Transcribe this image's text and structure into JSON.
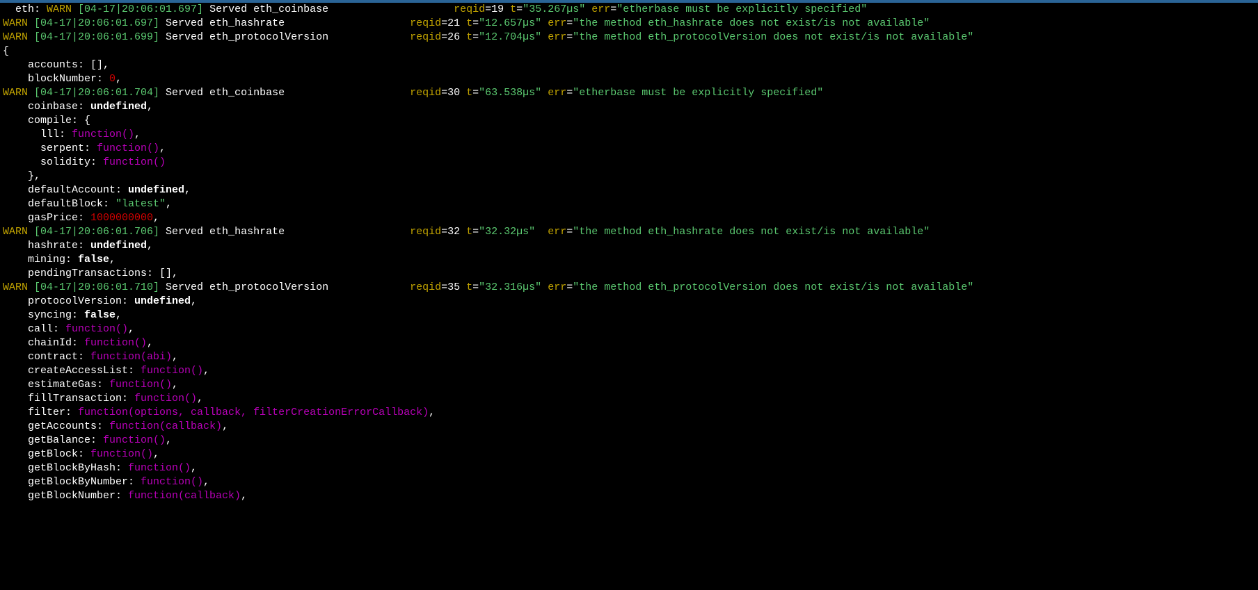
{
  "colors": {
    "warn": "#c2a400",
    "ts": "#5bc970",
    "num": "#d20000",
    "fn": "#b800b8"
  },
  "line0_prefix": "  eth: ",
  "logs": [
    {
      "warn": "WARN ",
      "ts": "[04-17|20:06:01.697]",
      "msg": " Served eth_coinbase                    ",
      "rk": "reqid",
      "rv": "=19 ",
      "tk": "t",
      "tv": "=",
      "tq": "\"35.267µs\"",
      "ek": " err",
      "ev": "=",
      "eq": "\"etherbase must be explicitly specified\""
    },
    {
      "warn": "WARN ",
      "ts": "[04-17|20:06:01.697]",
      "msg": " Served eth_hashrate                    ",
      "rk": "reqid",
      "rv": "=21 ",
      "tk": "t",
      "tv": "=",
      "tq": "\"12.657µs\"",
      "ek": " err",
      "ev": "=",
      "eq": "\"the method eth_hashrate does not exist/is not available\""
    },
    {
      "warn": "WARN ",
      "ts": "[04-17|20:06:01.699]",
      "msg": " Served eth_protocolVersion             ",
      "rk": "reqid",
      "rv": "=26 ",
      "tk": "t",
      "tv": "=",
      "tq": "\"12.704µs\"",
      "ek": " err",
      "ev": "=",
      "eq": "\"the method eth_protocolVersion does not exist/is not available\""
    }
  ],
  "braceOpen": "{",
  "props1": [
    {
      "key": "accounts: ",
      "val": "[],",
      "cls": "white"
    },
    {
      "key": "blockNumber: ",
      "val": "0",
      "cls": "num",
      "suffix": ","
    }
  ],
  "log3": {
    "warn": "WARN ",
    "ts": "[04-17|20:06:01.704]",
    "msg": " Served eth_coinbase                    ",
    "rk": "reqid",
    "rv": "=30 ",
    "tk": "t",
    "tv": "=",
    "tq": "\"63.538µs\"",
    "ek": " err",
    "ev": "=",
    "eq": "\"etherbase must be explicitly specified\""
  },
  "coinbase_key": "coinbase: ",
  "coinbase_val": "undefined",
  "compile_key": "compile: {",
  "compile": [
    {
      "key": "lll: ",
      "val": "function()",
      "suffix": ","
    },
    {
      "key": "serpent: ",
      "val": "function()",
      "suffix": ","
    },
    {
      "key": "solidity: ",
      "val": "function()",
      "suffix": ""
    }
  ],
  "compile_close": "},",
  "props2": [
    {
      "key": "defaultAccount: ",
      "val": "undefined",
      "cls": "bold",
      "suffix": ","
    },
    {
      "key": "defaultBlock: ",
      "val": "\"latest\"",
      "cls": "ts",
      "suffix": ","
    },
    {
      "key": "gasPrice: ",
      "val": "1000000000",
      "cls": "num",
      "suffix": ","
    }
  ],
  "log4": {
    "warn": "WARN ",
    "ts": "[04-17|20:06:01.706]",
    "msg": " Served eth_hashrate                    ",
    "rk": "reqid",
    "rv": "=32 ",
    "tk": "t",
    "tv": "=",
    "tq": "\"32.32µs\" ",
    "ek": " err",
    "ev": "=",
    "eq": "\"the method eth_hashrate does not exist/is not available\""
  },
  "props3": [
    {
      "key": "hashrate: ",
      "val": "undefined",
      "cls": "bold",
      "suffix": ","
    },
    {
      "key": "mining: ",
      "val": "false",
      "cls": "bold",
      "suffix": ","
    },
    {
      "key": "pendingTransactions: ",
      "val": "[],",
      "cls": "white",
      "suffix": ""
    }
  ],
  "log5": {
    "warn": "WARN ",
    "ts": "[04-17|20:06:01.710]",
    "msg": " Served eth_protocolVersion             ",
    "rk": "reqid",
    "rv": "=35 ",
    "tk": "t",
    "tv": "=",
    "tq": "\"32.316µs\"",
    "ek": " err",
    "ev": "=",
    "eq": "\"the method eth_protocolVersion does not exist/is not available\""
  },
  "props4": [
    {
      "key": "protocolVersion: ",
      "val": "undefined",
      "cls": "bold",
      "suffix": ","
    },
    {
      "key": "syncing: ",
      "val": "false",
      "cls": "bold",
      "suffix": ","
    },
    {
      "key": "call: ",
      "val": "function()",
      "cls": "fn",
      "suffix": ","
    },
    {
      "key": "chainId: ",
      "val": "function()",
      "cls": "fn",
      "suffix": ","
    },
    {
      "key": "contract: ",
      "val": "function(abi)",
      "cls": "fn",
      "suffix": ","
    },
    {
      "key": "createAccessList: ",
      "val": "function()",
      "cls": "fn",
      "suffix": ","
    },
    {
      "key": "estimateGas: ",
      "val": "function()",
      "cls": "fn",
      "suffix": ","
    },
    {
      "key": "fillTransaction: ",
      "val": "function()",
      "cls": "fn",
      "suffix": ","
    },
    {
      "key": "filter: ",
      "val": "function(options, callback, filterCreationErrorCallback)",
      "cls": "fn",
      "suffix": ","
    },
    {
      "key": "getAccounts: ",
      "val": "function(callback)",
      "cls": "fn",
      "suffix": ","
    },
    {
      "key": "getBalance: ",
      "val": "function()",
      "cls": "fn",
      "suffix": ","
    },
    {
      "key": "getBlock: ",
      "val": "function()",
      "cls": "fn",
      "suffix": ","
    },
    {
      "key": "getBlockByHash: ",
      "val": "function()",
      "cls": "fn",
      "suffix": ","
    },
    {
      "key": "getBlockByNumber: ",
      "val": "function()",
      "cls": "fn",
      "suffix": ","
    },
    {
      "key": "getBlockNumber: ",
      "val": "function(callback)",
      "cls": "fn",
      "suffix": ","
    }
  ]
}
